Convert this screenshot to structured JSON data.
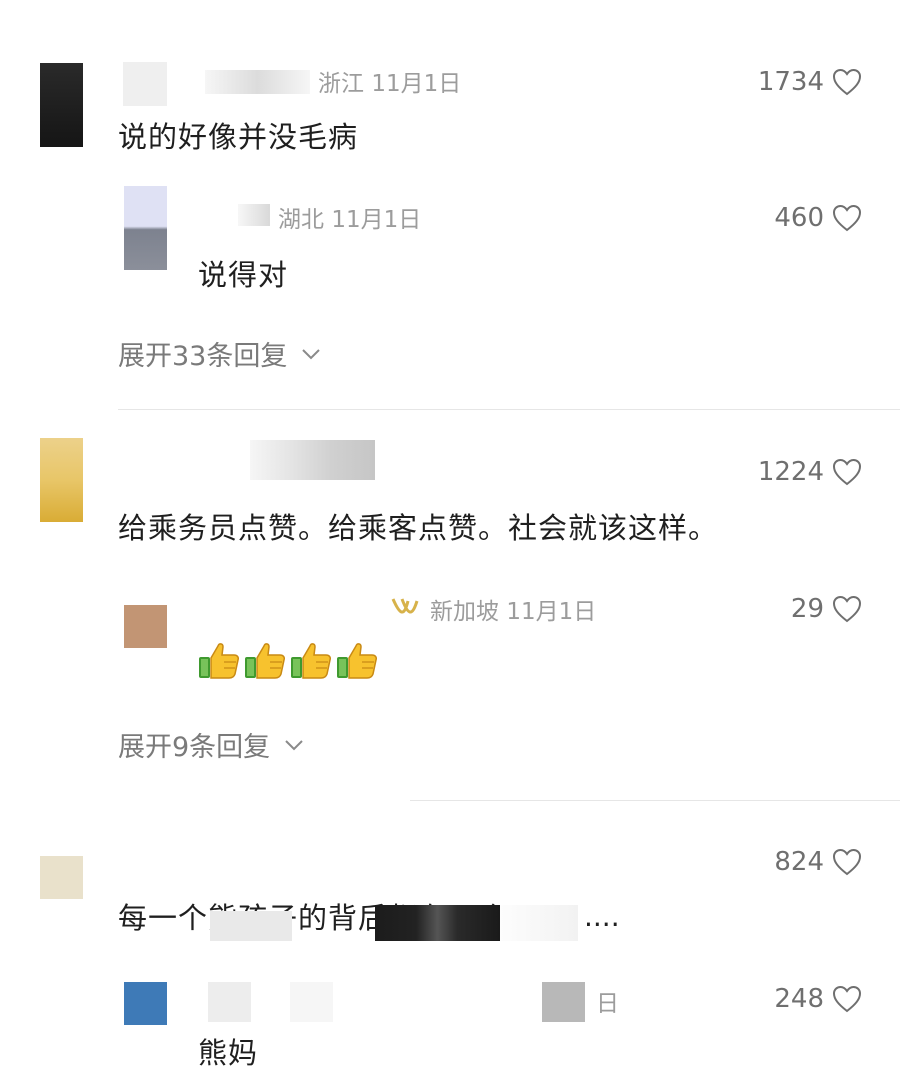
{
  "comments": [
    {
      "location": "浙江",
      "date": "11月1日",
      "text": "说的好像并没毛病",
      "likes": "1734",
      "reply": {
        "location": "湖北",
        "date": "11月1日",
        "text": "说得对",
        "likes": "460"
      },
      "expand_label": "展开33条回复"
    },
    {
      "text": "给乘务员点赞。给乘客点赞。社会就该这样。",
      "likes": "1224",
      "reply": {
        "location": "新加坡",
        "date": "11月1日",
        "likes": "29"
      },
      "expand_label": "展开9条回复"
    },
    {
      "text": "每一个熊孩子的背后都有一个",
      "ellipsis": "....",
      "likes": "824",
      "reply": {
        "date_fragment": "日",
        "text": "熊妈",
        "likes": "248"
      }
    }
  ],
  "icons": {
    "like": "heart-outline-icon",
    "expand": "chevron-down-icon",
    "reply_emoji": "thumbs-up-icon"
  },
  "colors": {
    "text": "#1f1f1f",
    "meta": "#9c9c9c",
    "likes": "#6f6f6f",
    "divider": "#e6e6e6"
  }
}
